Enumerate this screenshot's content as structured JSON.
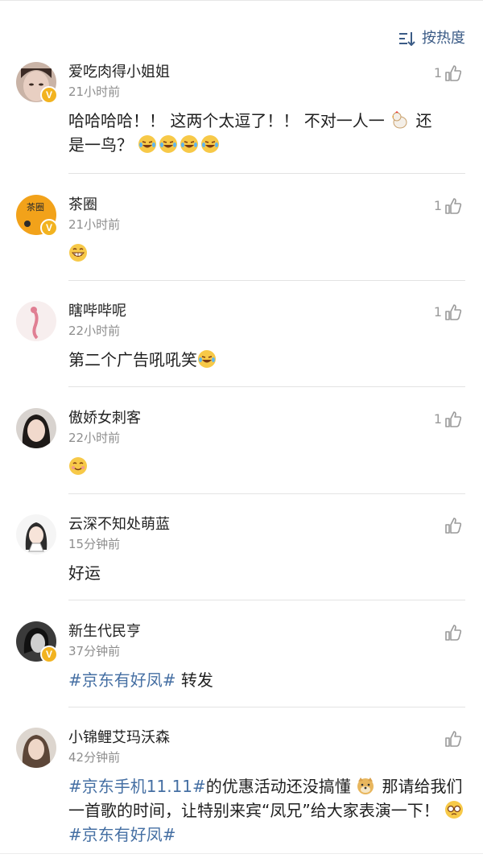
{
  "sort": {
    "label": "按热度",
    "icon": "sort-lines-icon"
  },
  "colors": {
    "link": "#456fa3",
    "badge": "#f2b320",
    "meta": "#8e8e8e"
  },
  "comments": [
    {
      "name": "爱吃肉得小姐姐",
      "time": "21小时前",
      "likes": "1",
      "verified": true,
      "text_1": "哈哈哈哈！！ 这两个太逗了！！ 不对一人一",
      "text_2": "还",
      "text_3": "是一鸟？"
    },
    {
      "name": "茶圈",
      "time": "21小时前",
      "likes": "1",
      "verified": true,
      "avatar_text": "茶圈"
    },
    {
      "name": "瞎哔哔呢",
      "time": "22小时前",
      "likes": "1",
      "text_1": "第二个广告吼吼笑"
    },
    {
      "name": "傲娇女刺客",
      "time": "22小时前",
      "likes": "1"
    },
    {
      "name": "云深不知处萌蓝",
      "time": "15分钟前",
      "likes": "",
      "text_1": "好运"
    },
    {
      "name": "新生代民亨",
      "time": "37分钟前",
      "likes": "",
      "verified": true,
      "tag": "#京东有好凤#",
      "text_1": " 转发"
    },
    {
      "name": "小锦鲤艾玛沃森",
      "time": "42分钟前",
      "likes": "",
      "tag_1": "#京东手机11.11#",
      "text_1": "的优惠活动还没搞懂",
      "text_2": " 那请给我们一首歌的时间，让特别来宾“凤兄”给大家表演一下！",
      "tag_2": "#京东有好凤#"
    }
  ]
}
